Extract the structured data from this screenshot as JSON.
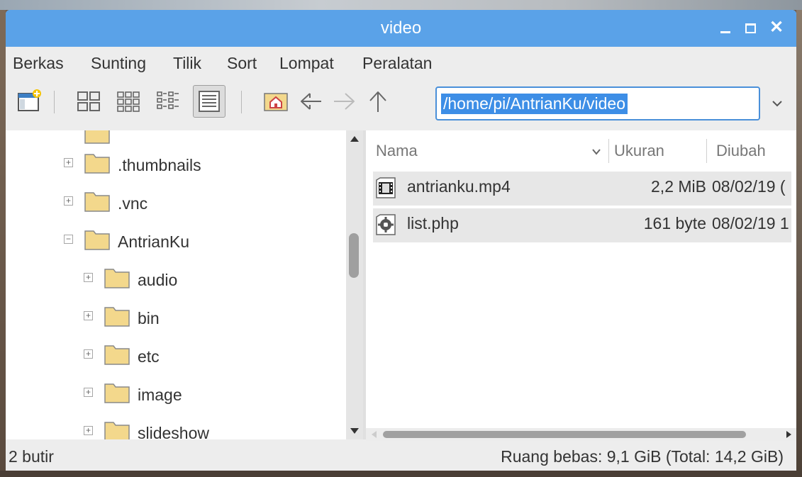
{
  "window": {
    "title": "video"
  },
  "menu": [
    "Berkas",
    "Sunting",
    "Tilik",
    "Sort",
    "Lompat",
    "Peralatan"
  ],
  "toolbar": {
    "path": "/home/pi/AntrianKu/video"
  },
  "tree": [
    {
      "label": ".thumbnails"
    },
    {
      "label": ".vnc"
    },
    {
      "label": "AntrianKu"
    },
    {
      "label": "audio"
    },
    {
      "label": "bin"
    },
    {
      "label": "etc"
    },
    {
      "label": "image"
    },
    {
      "label": "slideshow"
    }
  ],
  "columns": {
    "name": "Nama",
    "size": "Ukuran",
    "modified": "Diubah"
  },
  "files": [
    {
      "name": "antrianku.mp4",
      "size": "2,2 MiB",
      "modified": "08/02/19 (",
      "icon": "video-file-icon"
    },
    {
      "name": "list.php",
      "size": "161 byte",
      "modified": "08/02/19 1",
      "icon": "script-file-icon"
    }
  ],
  "status": {
    "count": "2 butir",
    "space": "Ruang bebas: 9,1 GiB (Total: 14,2 GiB)"
  },
  "colors": {
    "titlebar": "#5aa2e8",
    "selection": "#3d8ee6",
    "folder": "#f3d88c"
  }
}
